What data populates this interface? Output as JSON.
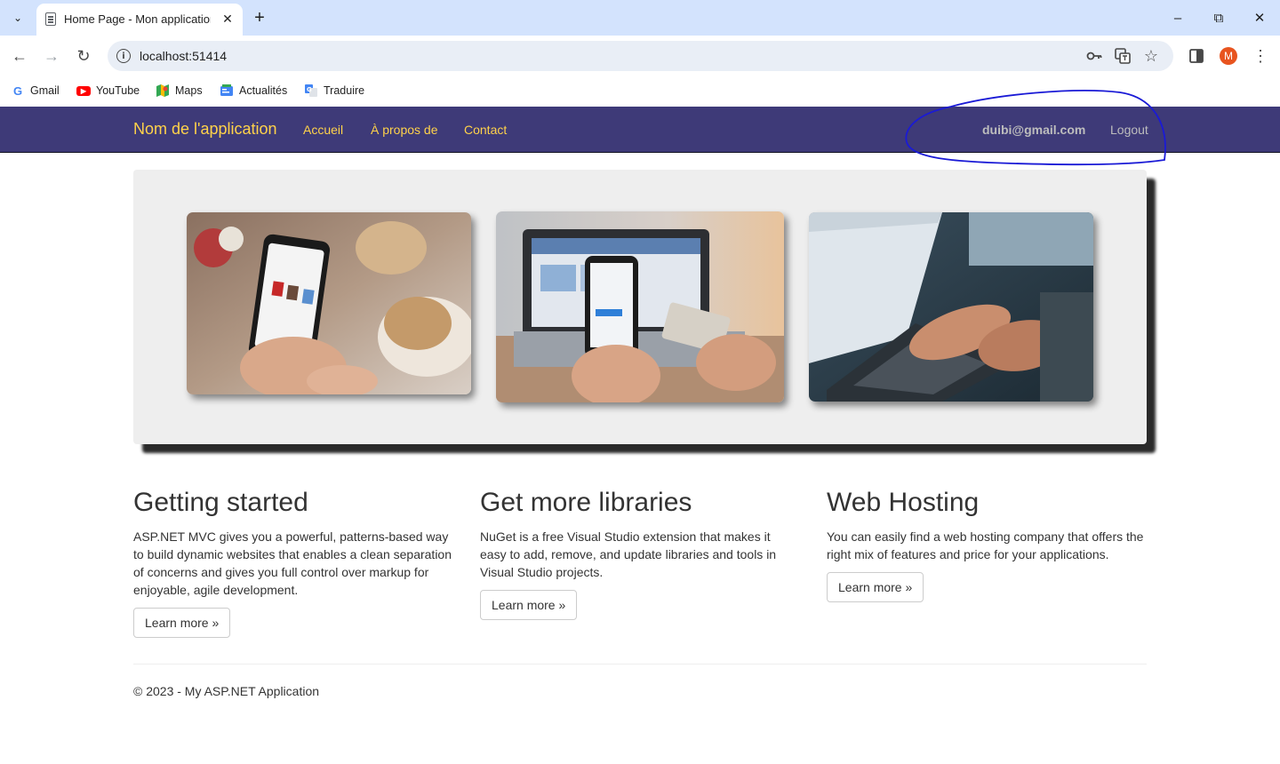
{
  "browser": {
    "tab_title": "Home Page - Mon application",
    "url": "localhost:51414",
    "profile_initial": "M",
    "bookmarks": [
      {
        "label": "Gmail",
        "icon": "gmail-icon"
      },
      {
        "label": "YouTube",
        "icon": "youtube-icon"
      },
      {
        "label": "Maps",
        "icon": "maps-icon"
      },
      {
        "label": "Actualités",
        "icon": "news-icon"
      },
      {
        "label": "Traduire",
        "icon": "translate-icon"
      }
    ]
  },
  "navbar": {
    "brand": "Nom de l'application",
    "links": [
      "Accueil",
      "À propos de",
      "Contact"
    ],
    "user_email": "duibi@gmail.com",
    "logout": "Logout"
  },
  "columns": [
    {
      "title": "Getting started",
      "text": "ASP.NET MVC gives you a powerful, patterns-based way to build dynamic websites that enables a clean separation of concerns and gives you full control over markup for enjoyable, agile development.",
      "button": "Learn more »"
    },
    {
      "title": "Get more libraries",
      "text": "NuGet is a free Visual Studio extension that makes it easy to add, remove, and update libraries and tools in Visual Studio projects.",
      "button": "Learn more »"
    },
    {
      "title": "Web Hosting",
      "text": "You can easily find a web hosting company that offers the right mix of features and price for your applications.",
      "button": "Learn more »"
    }
  ],
  "footer": "© 2023 - My ASP.NET Application",
  "colors": {
    "navbar_bg": "#3e3a78",
    "nav_link": "#ffd24a",
    "user_link": "#bdbdbd",
    "annotation_stroke": "#1a1ad6"
  }
}
